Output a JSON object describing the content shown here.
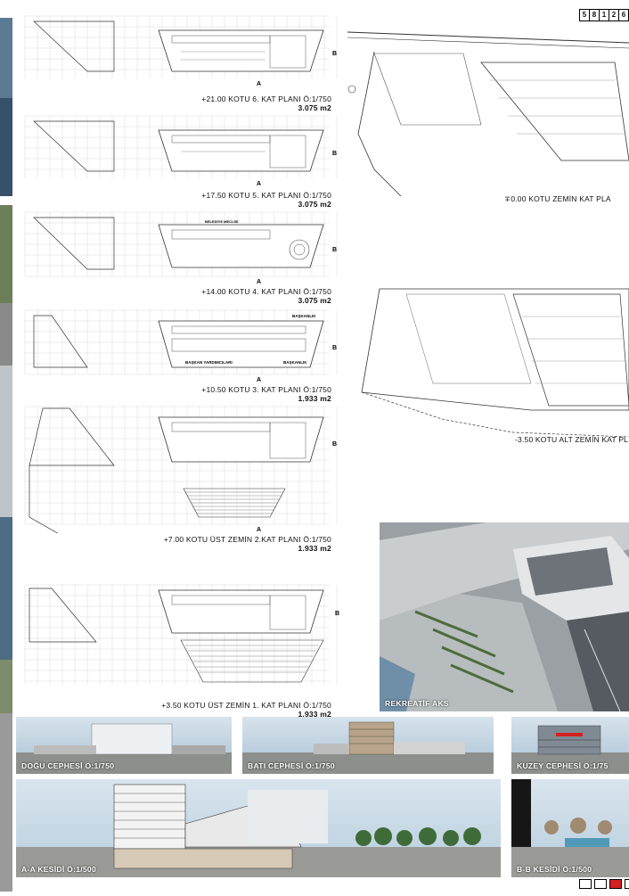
{
  "sheet_number": [
    "5",
    "8",
    "1",
    "2",
    "6"
  ],
  "plans": {
    "floor6": {
      "title": "+21.00 KOTU 6. KAT PLANI Ö:1/750",
      "area": "3.075 m2"
    },
    "floor5": {
      "title": "+17.50 KOTU 5. KAT PLANI Ö:1/750",
      "area": "3.075 m2"
    },
    "floor4": {
      "title": "+14.00 KOTU 4. KAT PLANI Ö:1/750",
      "area": "3.075 m2",
      "hall_label": "BELEDİYE MECLİSİ"
    },
    "floor3": {
      "title": "+10.50 KOTU 3. KAT PLANI Ö:1/750",
      "area": "1.933 m2",
      "label_top": "BAŞKANLIK",
      "label_left": "BAŞKAN YARDIMCILARI",
      "label_right": "BAŞKANLIK"
    },
    "floor2": {
      "title": "+7.00 KOTU ÜST ZEMİN 2.KAT PLANI Ö:1/750",
      "area": "1.933 m2"
    },
    "floor1": {
      "title": "+3.50 KOTU ÜST ZEMİN 1. KAT PLANI Ö:1/750",
      "area": "1.933 m2"
    },
    "ground": {
      "title": "∓0.00 KOTU ZEMİN KAT PLA"
    },
    "basement": {
      "title": "-3.50 KOTU ALT ZEMİN KAT PL"
    }
  },
  "section_markers": {
    "a": "A",
    "b": "B"
  },
  "render": {
    "label": "REKREATİF AKS"
  },
  "elevations": {
    "east": "DOĞU CEPHESİ Ö:1/750",
    "west": "BATI CEPHESİ Ö:1/750",
    "north": "KUZEY CEPHESİ Ö:1/75"
  },
  "sections": {
    "aa": "A-A KESİDİ Ö:1/500",
    "bb": "B-B KESİDİ Ö:1/500"
  },
  "colors": {
    "accent": "#d42020",
    "sky": "#b8cfe0",
    "grid": "#c8c8c8",
    "line": "#333333"
  }
}
